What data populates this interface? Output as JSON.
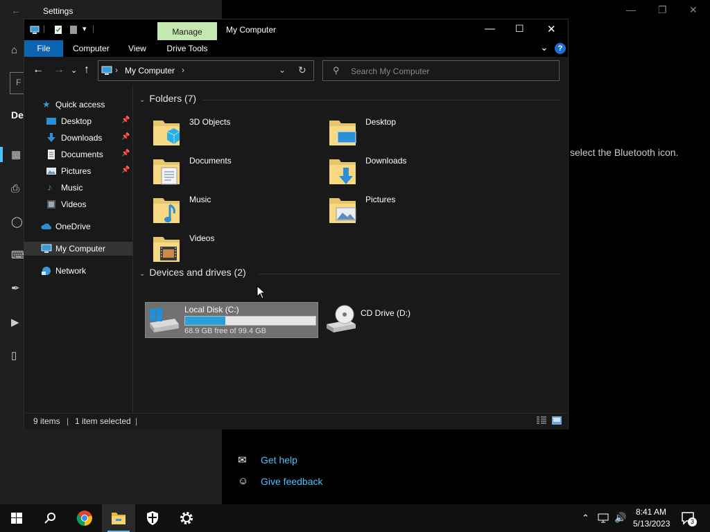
{
  "settings": {
    "title": "Settings",
    "partial_heading": "De",
    "search_stub": "F",
    "bluetooth_hint": "select the Bluetooth icon.",
    "get_help": "Get help",
    "give_feedback": "Give feedback"
  },
  "explorer": {
    "window_title": "My Computer",
    "context_tab": "Manage",
    "context_tab_sub": "Drive Tools",
    "ribbon_tabs": [
      "File",
      "Computer",
      "View"
    ],
    "address": {
      "crumbs": [
        "My Computer"
      ]
    },
    "search_placeholder": "Search My Computer",
    "nav": {
      "quick_access": "Quick access",
      "pinned": [
        "Desktop",
        "Downloads",
        "Documents",
        "Pictures"
      ],
      "unpinned": [
        "Music",
        "Videos"
      ],
      "onedrive": "OneDrive",
      "this_pc": "My Computer",
      "network": "Network"
    },
    "folders_header": "Folders (7)",
    "folders": [
      "3D Objects",
      "Desktop",
      "Documents",
      "Downloads",
      "Music",
      "Pictures",
      "Videos"
    ],
    "drives_header": "Devices and drives (2)",
    "drives": [
      {
        "name": "Local Disk (C:)",
        "free_text": "68.9 GB free of 99.4 GB",
        "used_fraction": 0.307
      },
      {
        "name": "CD Drive (D:)"
      }
    ],
    "status": {
      "items": "9 items",
      "selected": "1 item selected"
    }
  },
  "taskbar": {
    "time": "8:41 AM",
    "date": "5/13/2023",
    "notification_count": "3"
  },
  "colors": {
    "accent": "#0a64b0",
    "manage_tab": "#c4e8b0",
    "link": "#4cc2ff",
    "progress": "#26a0da"
  }
}
